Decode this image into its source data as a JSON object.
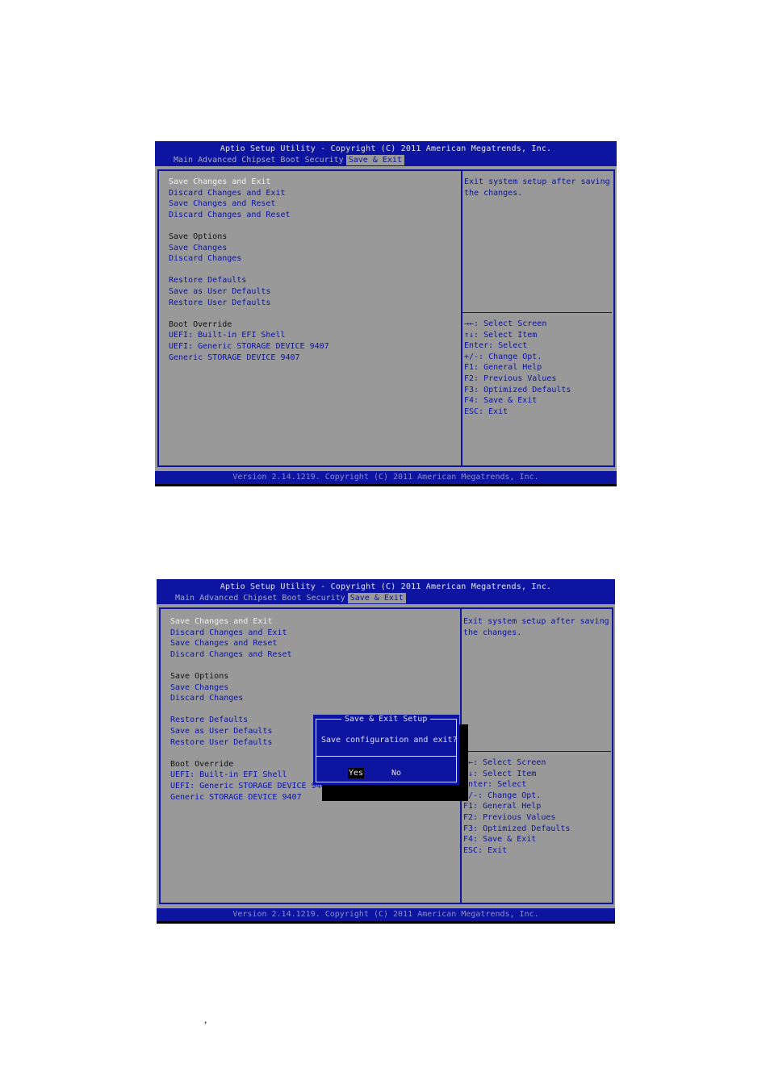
{
  "screens": [
    {
      "title": "Aptio Setup Utility - Copyright (C) 2011 American Megatrends, Inc.",
      "tabs": [
        "Main",
        "Advanced",
        "Chipset",
        "Boot",
        "Security",
        "Save & Exit"
      ],
      "active_tab": "Save & Exit",
      "menu": [
        {
          "label": "Save Changes and Exit",
          "type": "selected"
        },
        {
          "label": "Discard Changes and Exit",
          "type": "item"
        },
        {
          "label": "Save Changes and Reset",
          "type": "item"
        },
        {
          "label": "Discard Changes and Reset",
          "type": "item"
        },
        {
          "label": "",
          "type": "blank"
        },
        {
          "label": "Save Options",
          "type": "header"
        },
        {
          "label": "Save Changes",
          "type": "item"
        },
        {
          "label": "Discard Changes",
          "type": "item"
        },
        {
          "label": "",
          "type": "blank"
        },
        {
          "label": "Restore Defaults",
          "type": "item"
        },
        {
          "label": "Save as User Defaults",
          "type": "item"
        },
        {
          "label": "Restore User Defaults",
          "type": "item"
        },
        {
          "label": "",
          "type": "blank"
        },
        {
          "label": "Boot Override",
          "type": "header"
        },
        {
          "label": "UEFI: Built-in EFI Shell",
          "type": "item"
        },
        {
          "label": "UEFI: Generic STORAGE DEVICE 9407",
          "type": "item"
        },
        {
          "label": "Generic STORAGE DEVICE 9407",
          "type": "item"
        }
      ],
      "help": [
        "Exit system setup after saving",
        "the changes."
      ],
      "keys": [
        "→←: Select Screen",
        "↑↓: Select Item",
        "Enter: Select",
        "+/-: Change Opt.",
        "F1: General Help",
        "F2: Previous Values",
        "F3: Optimized Defaults",
        "F4: Save & Exit",
        "ESC: Exit"
      ],
      "footer": "Version 2.14.1219. Copyright (C) 2011 American Megatrends, Inc."
    },
    {
      "title": "Aptio Setup Utility - Copyright (C) 2011 American Megatrends, Inc.",
      "tabs": [
        "Main",
        "Advanced",
        "Chipset",
        "Boot",
        "Security",
        "Save & Exit"
      ],
      "active_tab": "Save & Exit",
      "menu": [
        {
          "label": "Save Changes and Exit",
          "type": "selected"
        },
        {
          "label": "Discard Changes and Exit",
          "type": "item"
        },
        {
          "label": "Save Changes and Reset",
          "type": "item"
        },
        {
          "label": "Discard Changes and Reset",
          "type": "item"
        },
        {
          "label": "",
          "type": "blank"
        },
        {
          "label": "Save Options",
          "type": "header"
        },
        {
          "label": "Save Changes",
          "type": "item"
        },
        {
          "label": "Discard Changes",
          "type": "item"
        },
        {
          "label": "",
          "type": "blank"
        },
        {
          "label": "Restore Defaults",
          "type": "item"
        },
        {
          "label": "Save as User Defaults",
          "type": "item"
        },
        {
          "label": "Restore User Defaults",
          "type": "item"
        },
        {
          "label": "",
          "type": "blank"
        },
        {
          "label": "Boot Override",
          "type": "header"
        },
        {
          "label": "UEFI: Built-in EFI Shell",
          "type": "item"
        },
        {
          "label": "UEFI: Generic STORAGE DEVICE 9407",
          "type": "item"
        },
        {
          "label": "Generic STORAGE DEVICE 9407",
          "type": "item"
        }
      ],
      "help": [
        "Exit system setup after saving",
        "the changes."
      ],
      "keys": [
        "→←: Select Screen",
        "↑↓: Select Item",
        "Enter: Select",
        "+/-: Change Opt.",
        "F1: General Help",
        "F2: Previous Values",
        "F3: Optimized Defaults",
        "F4: Save & Exit",
        "ESC: Exit"
      ],
      "footer": "Version 2.14.1219. Copyright (C) 2011 American Megatrends, Inc.",
      "dialog": {
        "title": "Save & Exit Setup",
        "message": "Save configuration and exit?",
        "buttons": [
          "Yes",
          "No"
        ],
        "active_button": "Yes"
      }
    }
  ],
  "page_text": {
    "stray_comma": ","
  },
  "colors": {
    "bios_blue": "#0c14a0",
    "bios_gray": "#999999",
    "selected_text": "#f0f0f0"
  }
}
